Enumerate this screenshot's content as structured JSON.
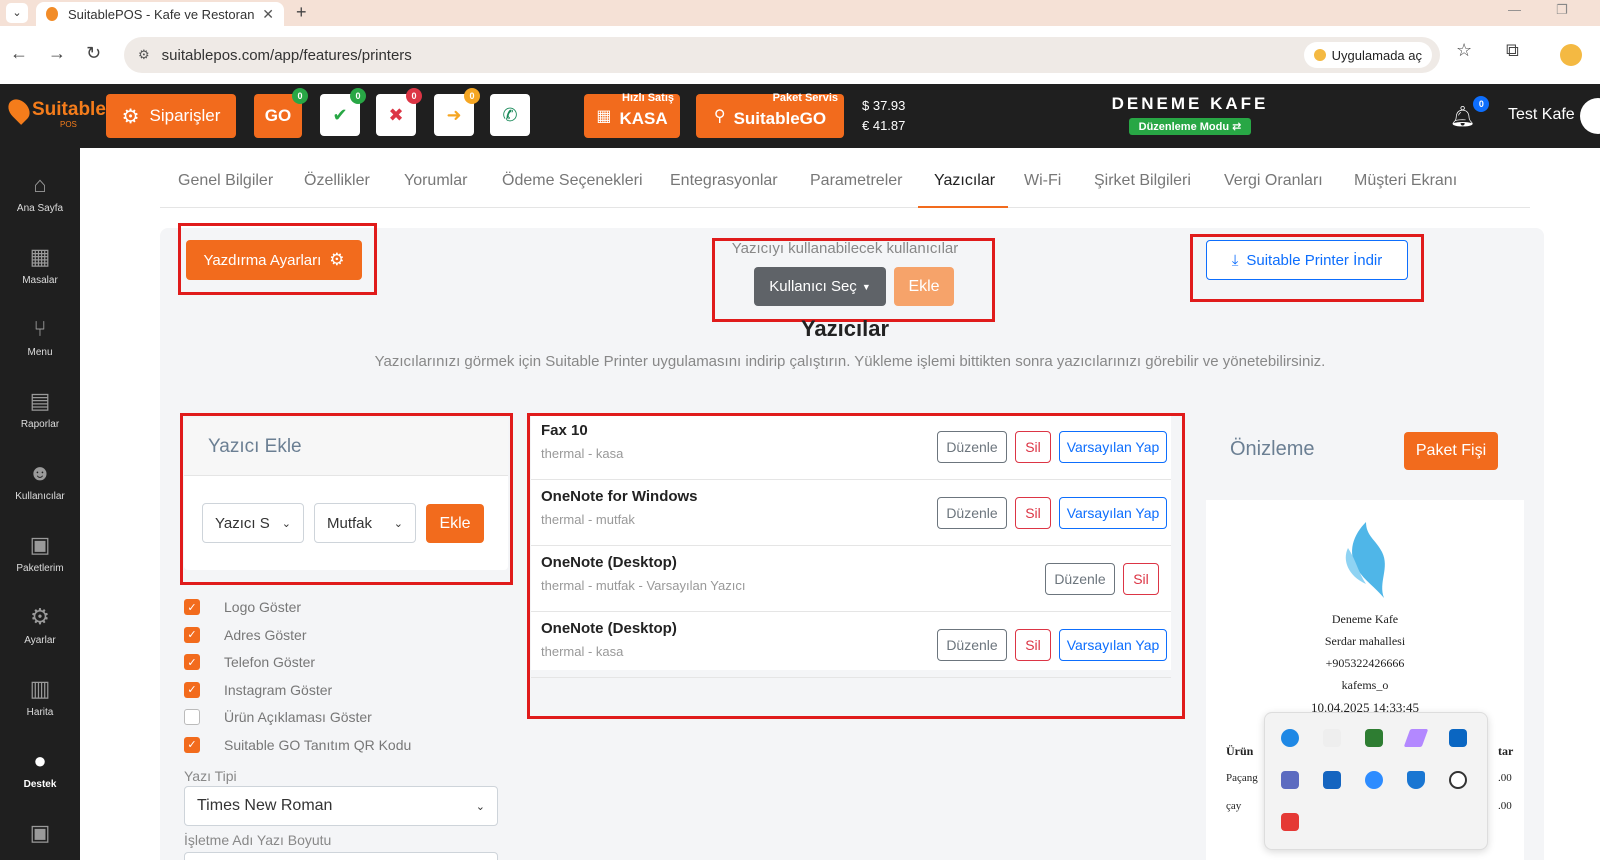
{
  "browser": {
    "tab_title": "SuitablePOS - Kafe ve Restoran",
    "url": "suitablepos.com/app/features/printers",
    "open_in_app": "Uygulamada aç"
  },
  "header": {
    "logo_text": "Suitable",
    "logo_sub": "POS",
    "orders_label": "Siparişler",
    "go_label": "GO",
    "badges": {
      "go": "0",
      "check": "0",
      "cross": "0",
      "arrow": "0"
    },
    "quick_sale_caption": "Hızlı Satış",
    "kasa_label": "KASA",
    "package_caption": "Paket Servis",
    "suitablego_label": "SuitableGO",
    "rate_usd": "$  37.93",
    "rate_eur": "€  41.87",
    "cafe_name": "DENEME KAFE",
    "edit_mode": "Düzenleme Modu",
    "notif_count": "0",
    "user_name": "Test Kafe"
  },
  "sidebar": {
    "items": [
      {
        "label": "Ana Sayfa",
        "icon": "home-icon",
        "glyph": "⌂"
      },
      {
        "label": "Masalar",
        "icon": "table-icon",
        "glyph": "▦"
      },
      {
        "label": "Menu",
        "icon": "utensils-icon",
        "glyph": "⑂"
      },
      {
        "label": "Raporlar",
        "icon": "report-icon",
        "glyph": "▤"
      },
      {
        "label": "Kullanıcılar",
        "icon": "users-icon",
        "glyph": "☻"
      },
      {
        "label": "Paketlerim",
        "icon": "gift-icon",
        "glyph": "▣"
      },
      {
        "label": "Ayarlar",
        "icon": "gears-icon",
        "glyph": "⚙"
      },
      {
        "label": "Harita",
        "icon": "map-icon",
        "glyph": "▥"
      },
      {
        "label": "Destek",
        "icon": "chat-icon",
        "glyph": "●"
      }
    ]
  },
  "feature_tabs": [
    "Genel Bilgiler",
    "Özellikler",
    "Yorumlar",
    "Ödeme Seçenekleri",
    "Entegrasyonlar",
    "Parametreler",
    "Yazıcılar",
    "Wi-Fi",
    "Şirket Bilgileri",
    "Vergi Oranları",
    "Müşteri Ekranı"
  ],
  "active_tab": "Yazıcılar",
  "printers_page": {
    "print_settings_button": "Yazdırma Ayarları",
    "users_caption": "Yazıcıyı kullanabilecek kullanıcılar",
    "select_user_button": "Kullanıcı Seç",
    "add_user_button": "Ekle",
    "download_button": "Suitable Printer İndir",
    "title": "Yazıcılar",
    "description": "Yazıcılarınızı görmek için Suitable Printer uygulamasını indirip çalıştırın. Yükleme işlemi bittikten sonra yazıcılarınızı görebilir ve yönetebilirsiniz."
  },
  "add_printer": {
    "title": "Yazıcı Ekle",
    "printer_select": "Yazıcı S",
    "category_select": "Mutfak",
    "add_button": "Ekle"
  },
  "options": [
    {
      "label": "Logo Göster",
      "checked": true
    },
    {
      "label": "Adres Göster",
      "checked": true
    },
    {
      "label": "Telefon Göster",
      "checked": true
    },
    {
      "label": "Instagram Göster",
      "checked": true
    },
    {
      "label": "Ürün Açıklaması Göster",
      "checked": false
    },
    {
      "label": "Suitable GO Tanıtım QR Kodu",
      "checked": true
    }
  ],
  "font_type_label": "Yazı Tipi",
  "font_type_value": "Times New Roman",
  "business_font_size_label": "İşletme Adı Yazı Boyutu",
  "printers": [
    {
      "name": "Fax 10",
      "meta": "thermal - kasa",
      "is_default": false
    },
    {
      "name": "OneNote for Windows",
      "meta": "thermal - mutfak",
      "is_default": false
    },
    {
      "name": "OneNote (Desktop)",
      "meta": "thermal - mutfak - Varsayılan Yazıcı",
      "is_default": true
    },
    {
      "name": "OneNote (Desktop)",
      "meta": "thermal - kasa",
      "is_default": false
    }
  ],
  "printer_actions": {
    "edit": "Düzenle",
    "delete": "Sil",
    "make_default": "Varsayılan Yap"
  },
  "preview": {
    "title": "Önizleme",
    "button": "Paket Fişi",
    "receipt": {
      "name": "Deneme Kafe",
      "address": "Serdar mahallesi",
      "phone": "+905322426666",
      "instagram": "kafems_o",
      "datetime": "10.04.2025 14:33:45",
      "col_product": "Ürün",
      "col_amount_partial": "tar",
      "row1_product": "Paçang",
      "row1_amount": ".00",
      "row2_product": "çay",
      "row2_amount": ".00"
    }
  },
  "colors": {
    "accent": "#f26b1d",
    "danger": "#dc3545",
    "primary": "#0d6efd",
    "highlight": "#e01b1b"
  }
}
